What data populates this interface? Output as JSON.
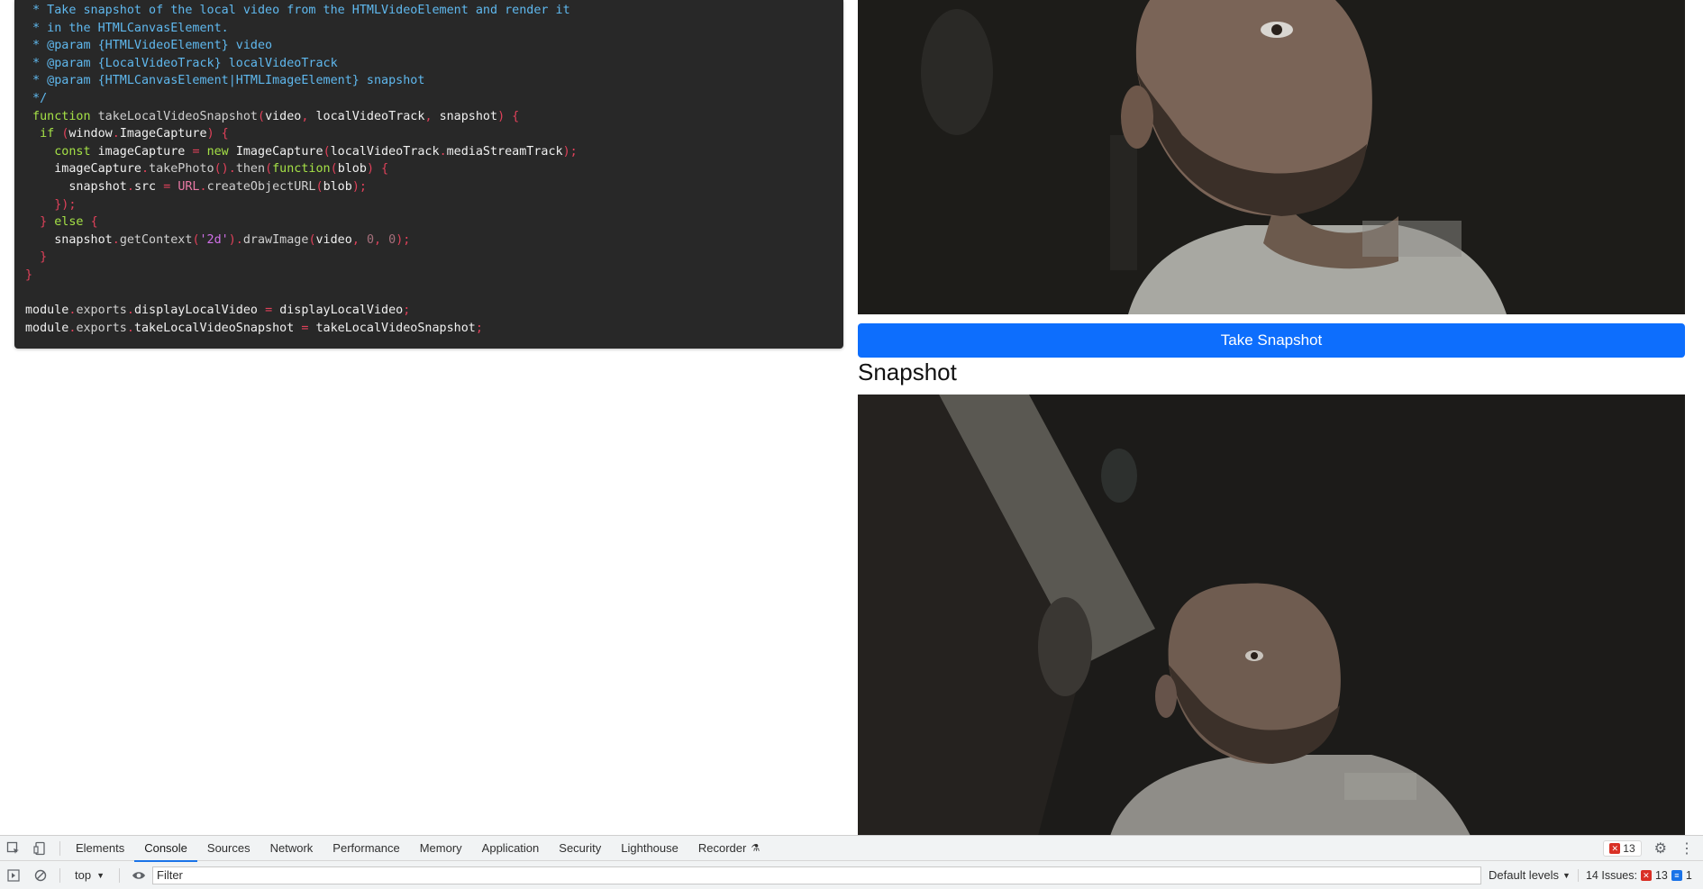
{
  "code_panel": {
    "lines": [
      [
        {
          "t": " * Take snapshot of the local video from the HTMLVideoElement and render it",
          "c": "cm"
        }
      ],
      [
        {
          "t": " * in the HTMLCanvasElement.",
          "c": "cm"
        }
      ],
      [
        {
          "t": " * @param {HTMLVideoElement} video",
          "c": "cm"
        }
      ],
      [
        {
          "t": " * @param {LocalVideoTrack} localVideoTrack",
          "c": "cm"
        }
      ],
      [
        {
          "t": " * @param {HTMLCanvasElement|HTMLImageElement} snapshot",
          "c": "cm"
        }
      ],
      [
        {
          "t": " */",
          "c": "cm"
        }
      ],
      [
        {
          "t": " function ",
          "c": "kw"
        },
        {
          "t": "takeLocalVideoSnapshot",
          "c": "fn"
        },
        {
          "t": "(",
          "c": "p"
        },
        {
          "t": "video",
          "c": "id"
        },
        {
          "t": ", ",
          "c": "p"
        },
        {
          "t": "localVideoTrack",
          "c": "id"
        },
        {
          "t": ", ",
          "c": "p"
        },
        {
          "t": "snapshot",
          "c": "id"
        },
        {
          "t": ") {",
          "c": "p"
        }
      ],
      [
        {
          "t": "  if ",
          "c": "kw"
        },
        {
          "t": "(",
          "c": "p"
        },
        {
          "t": "window",
          "c": "id"
        },
        {
          "t": ".",
          "c": "p"
        },
        {
          "t": "ImageCapture",
          "c": "id"
        },
        {
          "t": ") {",
          "c": "p"
        }
      ],
      [
        {
          "t": "    const ",
          "c": "kw"
        },
        {
          "t": "imageCapture ",
          "c": "id"
        },
        {
          "t": "= ",
          "c": "p"
        },
        {
          "t": "new ",
          "c": "kw"
        },
        {
          "t": "ImageCapture",
          "c": "id"
        },
        {
          "t": "(",
          "c": "p"
        },
        {
          "t": "localVideoTrack",
          "c": "id"
        },
        {
          "t": ".",
          "c": "p"
        },
        {
          "t": "mediaStreamTrack",
          "c": "id"
        },
        {
          "t": ");",
          "c": "p"
        }
      ],
      [
        {
          "t": "    imageCapture",
          "c": "id"
        },
        {
          "t": ".",
          "c": "p"
        },
        {
          "t": "takePhoto",
          "c": "fn"
        },
        {
          "t": "().",
          "c": "p"
        },
        {
          "t": "then",
          "c": "fn"
        },
        {
          "t": "(",
          "c": "p"
        },
        {
          "t": "function",
          "c": "kw"
        },
        {
          "t": "(",
          "c": "p"
        },
        {
          "t": "blob",
          "c": "id"
        },
        {
          "t": ") {",
          "c": "p"
        }
      ],
      [
        {
          "t": "      snapshot",
          "c": "id"
        },
        {
          "t": ".",
          "c": "p"
        },
        {
          "t": "src ",
          "c": "id"
        },
        {
          "t": "= ",
          "c": "p"
        },
        {
          "t": "URL",
          "c": "kw2"
        },
        {
          "t": ".",
          "c": "p"
        },
        {
          "t": "createObjectURL",
          "c": "fn"
        },
        {
          "t": "(",
          "c": "p"
        },
        {
          "t": "blob",
          "c": "id"
        },
        {
          "t": ");",
          "c": "p"
        }
      ],
      [
        {
          "t": "    });",
          "c": "p"
        }
      ],
      [
        {
          "t": "  } ",
          "c": "p"
        },
        {
          "t": "else ",
          "c": "kw"
        },
        {
          "t": "{",
          "c": "p"
        }
      ],
      [
        {
          "t": "    snapshot",
          "c": "id"
        },
        {
          "t": ".",
          "c": "p"
        },
        {
          "t": "getContext",
          "c": "fn"
        },
        {
          "t": "(",
          "c": "p"
        },
        {
          "t": "'2d'",
          "c": "str"
        },
        {
          "t": ").",
          "c": "p"
        },
        {
          "t": "drawImage",
          "c": "fn"
        },
        {
          "t": "(",
          "c": "p"
        },
        {
          "t": "video",
          "c": "id"
        },
        {
          "t": ", ",
          "c": "p"
        },
        {
          "t": "0",
          "c": "num"
        },
        {
          "t": ", ",
          "c": "p"
        },
        {
          "t": "0",
          "c": "num"
        },
        {
          "t": ");",
          "c": "p"
        }
      ],
      [
        {
          "t": "  }",
          "c": "p"
        }
      ],
      [
        {
          "t": "}",
          "c": "p"
        }
      ],
      [
        {
          "t": "",
          "c": "id"
        }
      ],
      [
        {
          "t": "module",
          "c": "id"
        },
        {
          "t": ".",
          "c": "p"
        },
        {
          "t": "exports",
          "c": "fn"
        },
        {
          "t": ".",
          "c": "p"
        },
        {
          "t": "displayLocalVideo ",
          "c": "id"
        },
        {
          "t": "= ",
          "c": "p"
        },
        {
          "t": "displayLocalVideo",
          "c": "id"
        },
        {
          "t": ";",
          "c": "p"
        }
      ],
      [
        {
          "t": "module",
          "c": "id"
        },
        {
          "t": ".",
          "c": "p"
        },
        {
          "t": "exports",
          "c": "fn"
        },
        {
          "t": ".",
          "c": "p"
        },
        {
          "t": "takeLocalVideoSnapshot ",
          "c": "id"
        },
        {
          "t": "= ",
          "c": "p"
        },
        {
          "t": "takeLocalVideoSnapshot",
          "c": "id"
        },
        {
          "t": ";",
          "c": "p"
        }
      ]
    ]
  },
  "main": {
    "take_snapshot_label": "Take Snapshot",
    "snapshot_heading": "Snapshot"
  },
  "devtools": {
    "tabs": [
      {
        "label": "Elements",
        "active": false
      },
      {
        "label": "Console",
        "active": true
      },
      {
        "label": "Sources",
        "active": false
      },
      {
        "label": "Network",
        "active": false
      },
      {
        "label": "Performance",
        "active": false
      },
      {
        "label": "Memory",
        "active": false
      },
      {
        "label": "Application",
        "active": false
      },
      {
        "label": "Security",
        "active": false
      },
      {
        "label": "Lighthouse",
        "active": false
      },
      {
        "label": "Recorder",
        "active": false
      }
    ],
    "error_count": "13",
    "context": "top",
    "filter_placeholder": "Filter",
    "levels_label": "Default levels",
    "issues_label": "14 Issues:",
    "issues_errors": "13",
    "issues_messages": "1"
  },
  "colors": {
    "code_background": "#282828",
    "accent_button": "#0d6efd",
    "devtools_active_tab": "#1a73e8",
    "error_red": "#d93025"
  },
  "icons": [
    "inspect-icon",
    "device-toolbar-icon",
    "flask-icon",
    "settings-gear-icon",
    "kebab-menu-icon",
    "sidebar-toggle-icon",
    "clear-console-icon",
    "eye-icon"
  ]
}
